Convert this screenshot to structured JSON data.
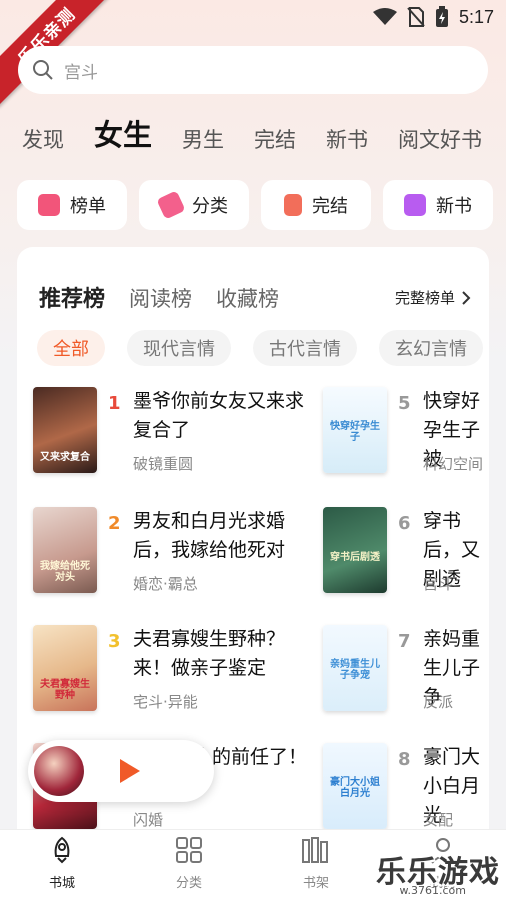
{
  "status_bar": {
    "time": "5:17"
  },
  "corner_ribbon": "乐乐亲测",
  "search": {
    "value": "宫斗"
  },
  "top_tabs": [
    "发现",
    "女生",
    "男生",
    "完结",
    "新书",
    "阅文好书"
  ],
  "top_tab_active": "女生",
  "quick_buttons": [
    {
      "label": "榜单",
      "icon": "ranking-icon",
      "color": "#f2557a"
    },
    {
      "label": "分类",
      "icon": "category-icon",
      "color": "#f3608c"
    },
    {
      "label": "完结",
      "icon": "book-done-icon",
      "color": "#f26e5a"
    },
    {
      "label": "新书",
      "icon": "new-book-icon",
      "color": "#b85cf0"
    }
  ],
  "ranking": {
    "tabs": [
      "推荐榜",
      "阅读榜",
      "收藏榜"
    ],
    "full_list": "完整榜单",
    "categories": [
      "全部",
      "现代言情",
      "古代言情",
      "玄幻言情"
    ],
    "accent": "#f05a28"
  },
  "books": [
    {
      "rank": "1",
      "title": "墨爷你前女友又来求复合了",
      "tag": "破镜重圆",
      "cover_text": "又来求复合",
      "rank_color": "#e84a3b"
    },
    {
      "rank": "2",
      "title": "男友和白月光求婚后，我嫁给他死对",
      "tag": "婚恋·霸总",
      "cover_text": "我嫁给他死对头",
      "rank_color": "#f08a2a"
    },
    {
      "rank": "3",
      "title": "夫君寡嫂生野种？来！做亲子鉴定",
      "tag": "宅斗·异能",
      "cover_text": "夫君寡嫂生野种",
      "rank_color": "#f2c12e"
    },
    {
      "rank": "4",
      "title": "人的前任了！",
      "tag": "闪婚",
      "cover_text": "",
      "rank_color": "#999999"
    },
    {
      "rank": "5",
      "title": "快穿好孕生子被",
      "tag": "科幻空间",
      "cover_text": "快穿好孕生子",
      "rank_color": "#999999"
    },
    {
      "rank": "6",
      "title": "穿书后，又剧透",
      "tag": "宫斗",
      "cover_text": "穿书后剧透",
      "rank_color": "#999999"
    },
    {
      "rank": "7",
      "title": "亲妈重生儿子争",
      "tag": "反派",
      "cover_text": "亲妈重生儿子争宠",
      "rank_color": "#999999"
    },
    {
      "rank": "8",
      "title": "豪门大小白月光",
      "tag": "女配",
      "cover_text": "豪门大小姐白月光",
      "rank_color": "#999999"
    }
  ],
  "bottom_nav": [
    "书城",
    "分类",
    "书架",
    "我的"
  ],
  "bottom_nav_active": "书城",
  "watermark": {
    "text": "乐乐游戏",
    "sub": "w.3761.com"
  }
}
